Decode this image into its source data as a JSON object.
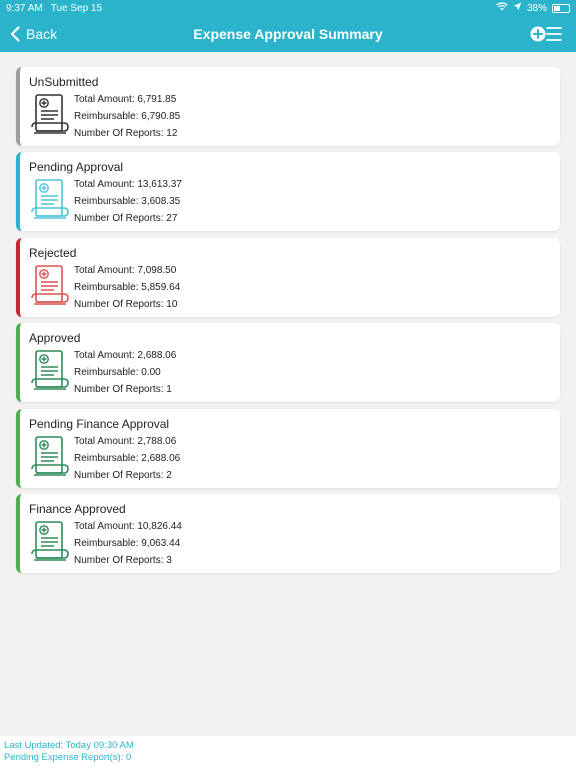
{
  "status_bar": {
    "time": "9:37 AM",
    "date": "Tue Sep 15",
    "battery": "38%",
    "battery_level": 0.38
  },
  "nav": {
    "back_label": "Back",
    "title": "Expense Approval Summary"
  },
  "labels": {
    "total": "Total Amount: ",
    "reimb": "Reimbursable: ",
    "count": "Number Of Reports: "
  },
  "cards": [
    {
      "title": "UnSubmitted",
      "total": "6,791.85",
      "reimbursable": "6,790.85",
      "reports": "12",
      "color": "#9e9e9e",
      "icon_color": "#333333"
    },
    {
      "title": "Pending Approval",
      "total": "13,613.37",
      "reimbursable": "3,608.35",
      "reports": "27",
      "color": "#2bb3cc",
      "icon_color": "#4fc3d9"
    },
    {
      "title": "Rejected",
      "total": "7,098.50",
      "reimbursable": "5,859.64",
      "reports": "10",
      "color": "#c62834",
      "icon_color": "#d9534f"
    },
    {
      "title": "Approved",
      "total": "2,688.06",
      "reimbursable": "0.00",
      "reports": "1",
      "color": "#4caf50",
      "icon_color": "#2e8b57"
    },
    {
      "title": "Pending Finance Approval",
      "total": "2,788.06",
      "reimbursable": "2,688.06",
      "reports": "2",
      "color": "#4caf50",
      "icon_color": "#2e8b57"
    },
    {
      "title": "Finance Approved",
      "total": "10,826.44",
      "reimbursable": "9,063.44",
      "reports": "3",
      "color": "#4caf50",
      "icon_color": "#2e8b57"
    }
  ],
  "footer": {
    "last_updated": "Last Updated: Today 09:30 AM",
    "pending": "Pending Expense Report(s): 0"
  }
}
